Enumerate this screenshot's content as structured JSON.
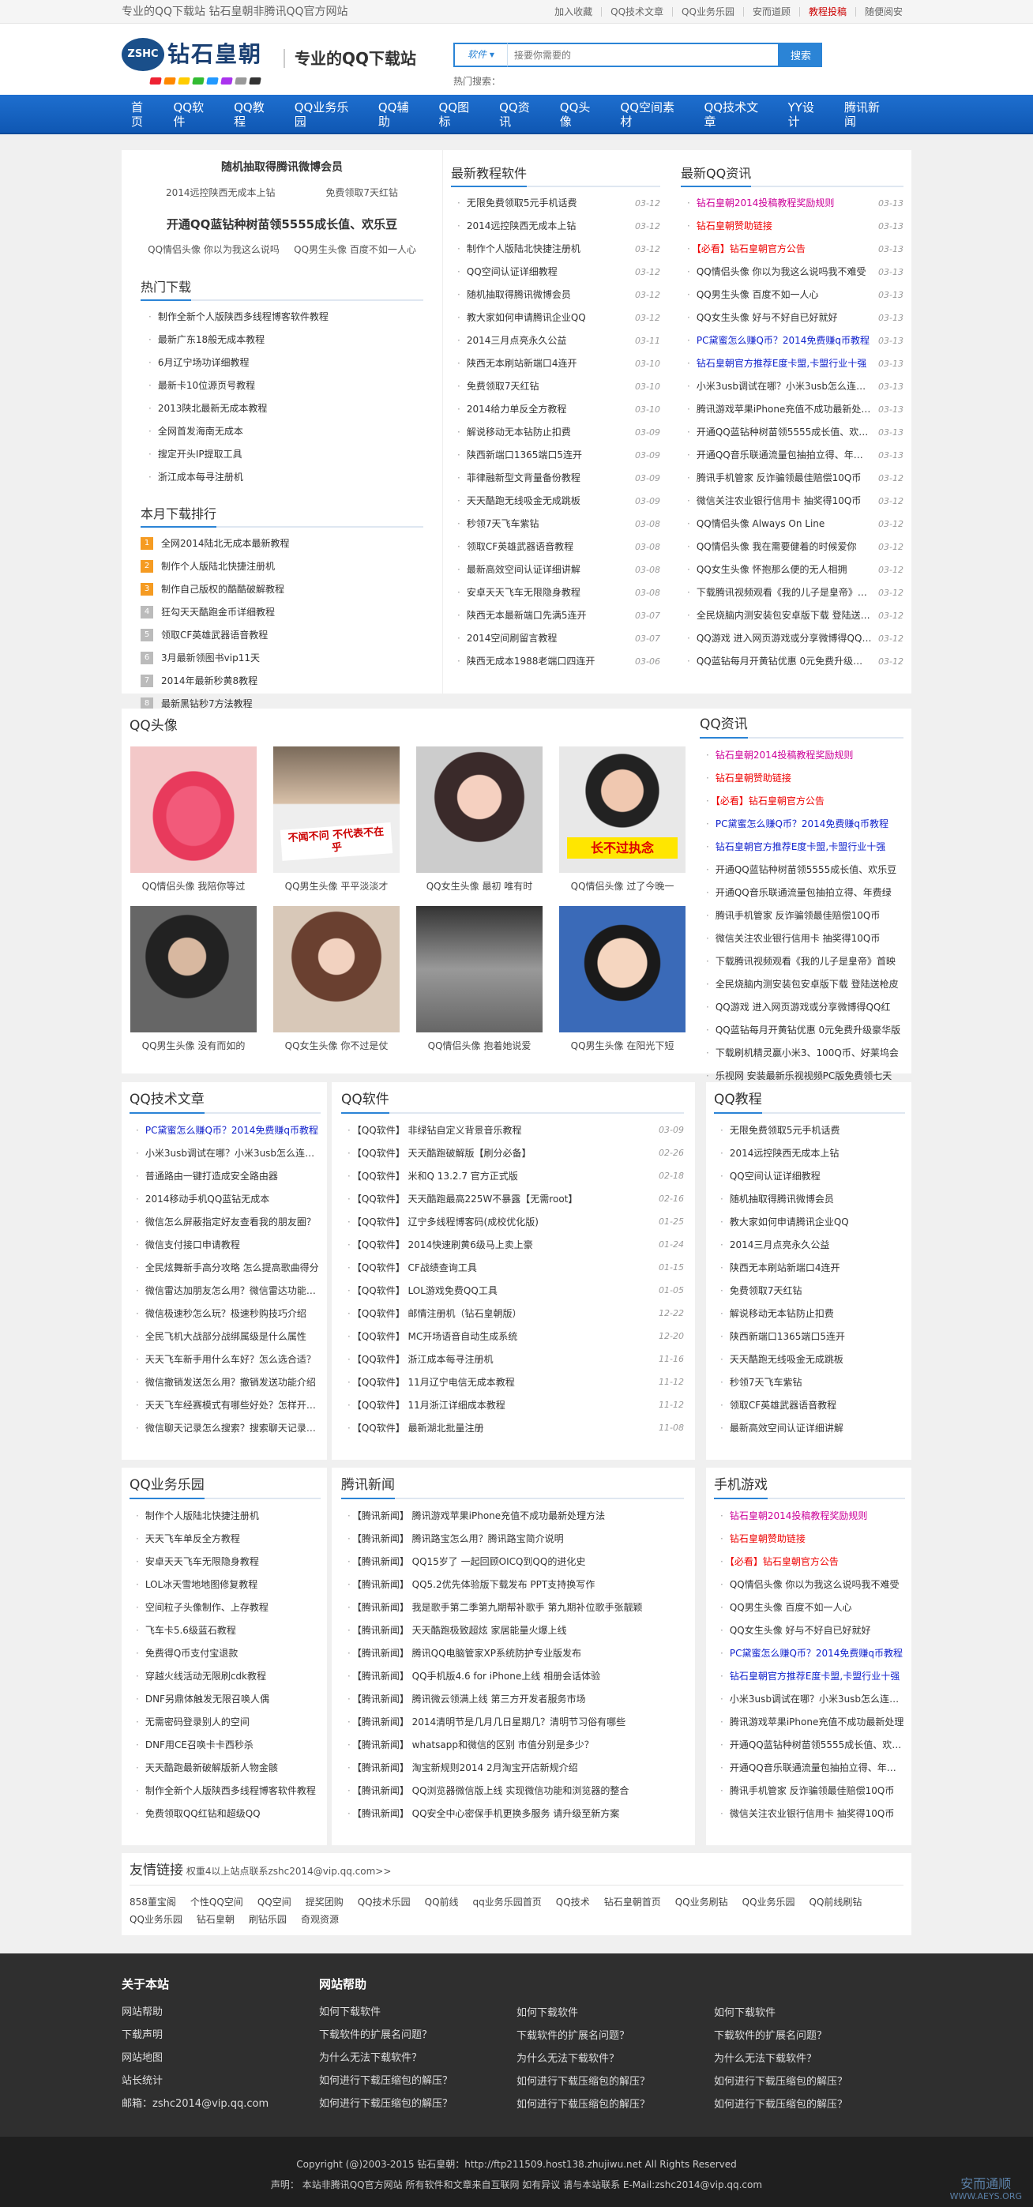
{
  "topbar": {
    "left": "专业的QQ下载站  钻石皇朝非腾讯QQ官方网站",
    "links": [
      "加入收藏",
      "QQ技术文章",
      "QQ业务乐园",
      "安而道顾",
      "教程投稿",
      "随便阅安"
    ]
  },
  "header": {
    "logo_badge": "ZSHC",
    "logo_name": "钻石皇朝",
    "slogan": "专业的QQ下载站",
    "search_category": "软件",
    "search_placeholder": "接要你需要的",
    "search_button": "搜索",
    "hot_keywords": "热门搜索："
  },
  "nav": [
    "首页",
    "QQ软件",
    "QQ教程",
    "QQ业务乐园",
    "QQ辅助",
    "QQ图标",
    "QQ资讯",
    "QQ头像",
    "QQ空间素材",
    "QQ技术文章",
    "YY设计",
    "腾讯新闻"
  ],
  "featured": {
    "title1": "随机抽取得腾讯微博会员",
    "pair1": [
      "2014远控陕西无成本上钻",
      "免费领取7天红钻"
    ],
    "title2": "开通QQ蓝钻种树苗领5555成长值、欢乐豆",
    "pair2": [
      "QQ情侣头像 你以为我这么说吗",
      "QQ男生头像 百度不如一人心"
    ]
  },
  "hot_downloads": {
    "title": "热门下载",
    "items": [
      "制作全新个人版陕西多线程博客软件教程",
      "最新广东18般无成本教程",
      "6月辽宁场功详细教程",
      "最新卡10位源页号教程",
      "2013陕北最新无成本教程",
      "全网首发海南无成本",
      "搜定开头IP提取工具",
      "浙江成本每寻注册机"
    ]
  },
  "monthly_rank": {
    "title": "本月下载排行",
    "items": [
      "全网2014陆北无成本最新教程",
      "制作个人版陆北快捷注册机",
      "制作自己版权的酷酷破解教程",
      "狂勾天天酷跑金币详细教程",
      "领取CF英雄武器语音教程",
      "3月最新领图书vip11天",
      "2014年最新秒黄8教程",
      "最新黑钻秒7方法教程"
    ]
  },
  "latest_tutorials": {
    "title": "最新教程软件",
    "items": [
      {
        "t": "无限免费领取5元手机话费",
        "d": "03-12"
      },
      {
        "t": "2014远控陕西无成本上钻",
        "d": "03-12"
      },
      {
        "t": "制作个人版陆北快捷注册机",
        "d": "03-12"
      },
      {
        "t": "QQ空间认证详细教程",
        "d": "03-12"
      },
      {
        "t": "随机抽取得腾讯微博会员",
        "d": "03-12"
      },
      {
        "t": "教大家如何申请腾讯企业QQ",
        "d": "03-12"
      },
      {
        "t": "2014三月点亮永久公益",
        "d": "03-11"
      },
      {
        "t": "陕西无本刷站新端口4连开",
        "d": "03-10"
      },
      {
        "t": "免费领取7天红钻",
        "d": "03-10"
      },
      {
        "t": "2014给力单反全方教程",
        "d": "03-10"
      },
      {
        "t": "解说移动无本钻防止扣费",
        "d": "03-09"
      },
      {
        "t": "陕西新端口1365端口5连开",
        "d": "03-09"
      },
      {
        "t": "菲律融新型文背量备份教程",
        "d": "03-09"
      },
      {
        "t": "天天酷跑无线吸金无成跳板",
        "d": "03-09"
      },
      {
        "t": "秒领7天飞车紫钻",
        "d": "03-08"
      },
      {
        "t": "领取CF英雄武器语音教程",
        "d": "03-08"
      },
      {
        "t": "最新高效空间认证详细讲解",
        "d": "03-08"
      },
      {
        "t": "安卓天天飞车无限隐身教程",
        "d": "03-08"
      },
      {
        "t": "陕西无本最新端口先满5连开",
        "d": "03-07"
      },
      {
        "t": "2014空间刷留言教程",
        "d": "03-07"
      },
      {
        "t": "陕西无成本1988老端口四连开",
        "d": "03-06"
      }
    ]
  },
  "latest_news": {
    "title": "最新QQ资讯",
    "items": [
      {
        "t": "钻石皇朝2014投稿教程奖励规则",
        "d": "03-13",
        "c": "pink"
      },
      {
        "t": "钻石皇朝赞助链接",
        "d": "03-13",
        "c": "red"
      },
      {
        "t": "【必看】钻石皇朝官方公告",
        "d": "03-13",
        "c": "red"
      },
      {
        "t": "QQ情侣头像 你以为我这么说吗我不难受",
        "d": "03-13",
        "c": ""
      },
      {
        "t": "QQ男生头像 百度不如一人心",
        "d": "03-13",
        "c": ""
      },
      {
        "t": "QQ女生头像 好与不好自已好就好",
        "d": "03-13",
        "c": ""
      },
      {
        "t": "PC黛蜜怎么赚Q币？2014免费赚q币教程",
        "d": "03-13",
        "c": "blue"
      },
      {
        "t": "钻石皇朝官方推荐E度卡盟,卡盟行业十强",
        "d": "03-13",
        "c": "blue"
      },
      {
        "t": "小米3usb调试在哪？小米3usb怎么连接电脑",
        "d": "03-13",
        "c": ""
      },
      {
        "t": "腾讯游戏苹果iPhone充值不成功最新处理方法",
        "d": "03-13",
        "c": ""
      },
      {
        "t": "开通QQ蓝钻种树苗领5555成长值、欢乐豆",
        "d": "03-13",
        "c": ""
      },
      {
        "t": "开通QQ音乐联通流量包抽拍立得、年费绿钻",
        "d": "03-13",
        "c": ""
      },
      {
        "t": "腾讯手机管家 反诈骗领最佳赔偿10Q币",
        "d": "03-12",
        "c": ""
      },
      {
        "t": "微信关注农业银行信用卡 抽奖得10Q币",
        "d": "03-12",
        "c": ""
      },
      {
        "t": "QQ情侣头像 Always On Line",
        "d": "03-12",
        "c": ""
      },
      {
        "t": "QQ情侣头像 我在需要健着的时候爱你",
        "d": "03-12",
        "c": ""
      },
      {
        "t": "QQ女生头像 怀抱那么便的无人相拥",
        "d": "03-12",
        "c": ""
      },
      {
        "t": "下载腾讯视频观看《我的儿子是皇帝》首映",
        "d": "03-12",
        "c": ""
      },
      {
        "t": "全民烧脑内测安装包安卓版下载 登陆送枪皮肤",
        "d": "03-12",
        "c": ""
      },
      {
        "t": "QQ游戏 进入网页游戏或分享微博得QQ红包",
        "d": "03-12",
        "c": ""
      },
      {
        "t": "QQ蓝钻每月开黄钻优惠 0元免费升级豪华版",
        "d": "03-12",
        "c": ""
      }
    ]
  },
  "avatars": {
    "title": "QQ头像",
    "items": [
      "QQ情侣头像 我陪你等过",
      "QQ男生头像 平平淡淡才",
      "QQ女生头像 最初 唯有时",
      "QQ情侣头像 过了今晚一",
      "QQ男生头像 没有而如的",
      "QQ女生头像 你不过是仗",
      "QQ情侣头像 抱着她说爱",
      "QQ男生头像 在阳光下短"
    ],
    "overlay1": "不闻不问 不代表不在乎",
    "overlay2": "长不过执念"
  },
  "qq_news_side": {
    "title": "QQ资讯",
    "items": [
      {
        "t": "钻石皇朝2014投稿教程奖励规则",
        "c": "pink"
      },
      {
        "t": "钻石皇朝赞助链接",
        "c": "red"
      },
      {
        "t": "【必看】钻石皇朝官方公告",
        "c": "red"
      },
      {
        "t": "PC黛蜜怎么赚Q币？2014免费赚q币教程",
        "c": "blue"
      },
      {
        "t": "钻石皇朝官方推荐E度卡盟,卡盟行业十强",
        "c": "blue"
      },
      {
        "t": "开通QQ蓝钻种树苗领5555成长值、欢乐豆",
        "c": ""
      },
      {
        "t": "开通QQ音乐联通流量包抽拍立得、年费绿",
        "c": ""
      },
      {
        "t": "腾讯手机管家 反诈骗领最佳赔偿10Q币",
        "c": ""
      },
      {
        "t": "微信关注农业银行信用卡 抽奖得10Q币",
        "c": ""
      },
      {
        "t": "下载腾讯视频观看《我的儿子是皇帝》首映",
        "c": ""
      },
      {
        "t": "全民烧脑内测安装包安卓版下载 登陆送枪皮",
        "c": ""
      },
      {
        "t": "QQ游戏 进入网页游戏或分享微博得QQ红",
        "c": ""
      },
      {
        "t": "QQ蓝钻每月开黄钻优惠 0元免费升级豪华版",
        "c": ""
      },
      {
        "t": "下载刷机精灵赢小米3、100Q币、好莱坞会",
        "c": ""
      },
      {
        "t": "乐视网 安装最新乐视视频PC版免费领七天",
        "c": ""
      }
    ]
  },
  "tech_articles": {
    "title": "QQ技术文章",
    "items": [
      {
        "t": "PC黛蜜怎么赚Q币？2014免费赚q币教程",
        "c": "blue"
      },
      {
        "t": "小米3usb调试在哪？小米3usb怎么连接电",
        "c": ""
      },
      {
        "t": "普通路由一键打造成安全路由器",
        "c": ""
      },
      {
        "t": "2014移动手机QQ蓝钻无成本",
        "c": ""
      },
      {
        "t": "微信怎么屏蔽指定好友查看我的朋友圈？",
        "c": ""
      },
      {
        "t": "微信支付接口申请教程",
        "c": ""
      },
      {
        "t": "全民炫舞新手高分攻略 怎么提高歌曲得分",
        "c": ""
      },
      {
        "t": "微信雷达加朋友怎么用？微信雷达功能介绍",
        "c": ""
      },
      {
        "t": "微信极速秒怎么玩？极速秒购技巧介绍",
        "c": ""
      },
      {
        "t": "全民飞机大战部分战绑属级是什么属性",
        "c": ""
      },
      {
        "t": "天天飞车新手用什么车好？怎么选合适？",
        "c": ""
      },
      {
        "t": "微信撤销发送怎么用？撤销发送功能介绍",
        "c": ""
      },
      {
        "t": "天天飞车经赛模式有哪些好处？怎样开启？",
        "c": ""
      },
      {
        "t": "微信聊天记录怎么搜索？搜索聊天记录方法",
        "c": ""
      }
    ]
  },
  "qq_software": {
    "title": "QQ软件",
    "items": [
      {
        "t": "【QQ软件】 非绿钻自定义背景音乐教程",
        "d": "03-09"
      },
      {
        "t": "【QQ软件】 天天酷跑破解版【刷分必备】",
        "d": "02-26"
      },
      {
        "t": "【QQ软件】 米和Q 13.2.7 官方正式版",
        "d": "02-18"
      },
      {
        "t": "【QQ软件】 天天酷跑最高225W不暴露【无需root】",
        "d": "02-16"
      },
      {
        "t": "【QQ软件】 辽宁多线程博客码(成校优化版)",
        "d": "01-25"
      },
      {
        "t": "【QQ软件】 2014快速刷黄6级马上卖上豪",
        "d": "01-24"
      },
      {
        "t": "【QQ软件】 CF战绩查询工具",
        "d": "01-15"
      },
      {
        "t": "【QQ软件】 LOL游戏免费QQ工具",
        "d": "01-05"
      },
      {
        "t": "【QQ软件】 邮情注册机（钻石皇朝版）",
        "d": "12-22"
      },
      {
        "t": "【QQ软件】 MC开场语音自动生成系统",
        "d": "12-20"
      },
      {
        "t": "【QQ软件】 浙江成本每寻注册机",
        "d": "11-16"
      },
      {
        "t": "【QQ软件】 11月辽宁电信无成本教程",
        "d": "11-12"
      },
      {
        "t": "【QQ软件】 11月浙江详细成本教程",
        "d": "11-12"
      },
      {
        "t": "【QQ软件】 最新湖北批量注册",
        "d": "11-08"
      }
    ]
  },
  "qq_tutorials": {
    "title": "QQ教程",
    "items": [
      "无限免费领取5元手机话费",
      "2014远控陕西无成本上钻",
      "QQ空间认证详细教程",
      "随机抽取得腾讯微博会员",
      "教大家如何申请腾讯企业QQ",
      "2014三月点亮永久公益",
      "陕西无本刷站新端口4连开",
      "免费领取7天红钻",
      "解说移动无本钻防止扣费",
      "陕西新端口1365端口5连开",
      "天天酷跑无线吸金无成跳板",
      "秒领7天飞车紫钻",
      "领取CF英雄武器语音教程",
      "最新高效空间认证详细讲解"
    ]
  },
  "qq_business": {
    "title": "QQ业务乐园",
    "items": [
      "制作个人版陆北快捷注册机",
      "天天飞车单反全方教程",
      "安卓天天飞车无限隐身教程",
      "LOL冰天雪地地图修复教程",
      "空间粒子头像制作、上存教程",
      "飞车卡5.6级蓝石教程",
      "免费得Q币支付宝退款",
      "穿越火线活动无限刷cdk教程",
      "DNF另鼎体触发无限召唤人偶",
      "无需密码登录别人的空间",
      "DNF用CE召唤卡卡西秒杀",
      "天天酷跑最新破解版新人物金骸",
      "制作全新个人版陕西多线程博客软件教程",
      "免费领取QQ红钻和超级QQ"
    ]
  },
  "tencent_news": {
    "title": "腾讯新闻",
    "items": [
      "【腾讯新闻】 腾讯游戏苹果iPhone充值不成功最新处理方法",
      "【腾讯新闻】 腾讯路宝怎么用？腾讯路宝简介说明",
      "【腾讯新闻】 QQ15岁了 一起回顾OICQ到QQ的进化史",
      "【腾讯新闻】 QQ5.2优先体验版下载发布 PPT支持换写作",
      "【腾讯新闻】 我是歌手第二季第九期帮补歌手 第九期补位歌手张靓颖",
      "【腾讯新闻】 天天酷跑极致超炫 家居能量火爆上线",
      "【腾讯新闻】 腾讯QQ电脑管家XP系统防护专业版发布",
      "【腾讯新闻】 QQ手机版4.6 for iPhone上线 相册会话体验",
      "【腾讯新闻】 腾讯微云领满上线 第三方开发者服务市场",
      "【腾讯新闻】 2014清明节是几月几日星期几？清明节习俗有哪些",
      "【腾讯新闻】 whatsapp和微信的区别 市值分别是多少？",
      "【腾讯新闻】 淘宝新规则2014 2月淘宝开店新规介绍",
      "【腾讯新闻】 QQ浏览器微信版上线 实现微信功能和浏览器的整合",
      "【腾讯新闻】 QQ安全中心密保手机更换多服务 请升级至新方案"
    ]
  },
  "mobile_games": {
    "title": "手机游戏",
    "items": [
      {
        "t": "钻石皇朝2014投稿教程奖励规则",
        "c": "pink"
      },
      {
        "t": "钻石皇朝赞助链接",
        "c": "red"
      },
      {
        "t": "【必看】钻石皇朝官方公告",
        "c": "red"
      },
      {
        "t": "QQ情侣头像 你以为我这么说吗我不难受",
        "c": ""
      },
      {
        "t": "QQ男生头像 百度不如一人心",
        "c": ""
      },
      {
        "t": "QQ女生头像 好与不好自已好就好",
        "c": ""
      },
      {
        "t": "PC黛蜜怎么赚Q币？2014免费赚q币教程",
        "c": "blue"
      },
      {
        "t": "钻石皇朝官方推荐E度卡盟,卡盟行业十强",
        "c": "blue"
      },
      {
        "t": "小米3usb调试在哪？小米3usb怎么连接电",
        "c": ""
      },
      {
        "t": "腾讯游戏苹果iPhone充值不成功最新处理",
        "c": ""
      },
      {
        "t": "开通QQ蓝钻种树苗领5555成长值、欢乐豆",
        "c": ""
      },
      {
        "t": "开通QQ音乐联通流量包抽拍立得、年费绿",
        "c": ""
      },
      {
        "t": "腾讯手机管家 反诈骗领最佳赔偿10Q币",
        "c": ""
      },
      {
        "t": "微信关注农业银行信用卡 抽奖得10Q币",
        "c": ""
      }
    ]
  },
  "friend_links": {
    "title": "友情链接",
    "note": "权重4以上站点联系zshc2014@vip.qq.com>>",
    "items": [
      "858董宝阁",
      "个性QQ空间",
      "QQ空间",
      "提奖团购",
      "QQ技术乐园",
      "QQ前线",
      "qq业务乐园首页",
      "QQ技术",
      "钻石皇朝首页",
      "QQ业务刷钻",
      "QQ业务乐园",
      "QQ前线刷钻",
      "QQ业务乐园",
      "钻石皇朝",
      "刷钻乐园",
      "奇观资源"
    ]
  },
  "footer": {
    "about_title": "关于本站",
    "about_items": [
      "网站帮助",
      "下载声明",
      "网站地图",
      "站长统计",
      "邮箱：zshc2014@vip.qq.com"
    ],
    "help_title": "网站帮助",
    "help_col": [
      "如何下载软件",
      "下载软件的扩展名问题？",
      "为什么无法下载软件？",
      "如何进行下载压缩包的解压？",
      "如何进行下载压缩包的解压？"
    ]
  },
  "bottom": {
    "copyright": "Copyright (@)2003-2015 钻石皇朝：http://ftp211509.host138.zhujiwu.net All Rights Reserved",
    "statement": "声明：   本站非腾讯QQ官方网站 所有软件和文章来自互联网 如有异议 请与本站联系      E-Mail:zshc2014@vip.qq.com",
    "watermark1": "安而通顺",
    "watermark2": "WWW.AEYS.ORG"
  },
  "colors": {
    "brand": "#1a6fcf",
    "red": "#e00000",
    "blue": "#1122cc",
    "pink": "#cc0099",
    "footer": "#2f2f2f"
  }
}
